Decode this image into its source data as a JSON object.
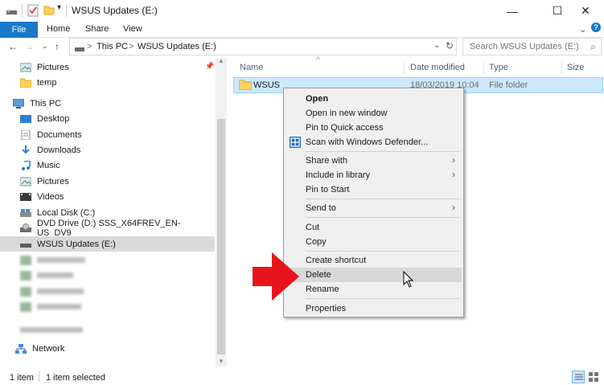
{
  "window": {
    "title": "WSUS Updates (E:)",
    "min_glyph": "—",
    "max_glyph": "☐",
    "close_glyph": "✕"
  },
  "ribbon": {
    "file": "File",
    "home": "Home",
    "share": "Share",
    "view": "View"
  },
  "address": {
    "crumb_pc": "This PC",
    "sep": ">",
    "crumb_drive": "WSUS Updates (E:)",
    "search_placeholder": "Search WSUS Updates (E:)"
  },
  "nav": {
    "items": [
      {
        "label": "Pictures",
        "icon": "pictures-icon"
      },
      {
        "label": "temp",
        "icon": "folder-icon"
      },
      {
        "label": "This PC",
        "icon": "pc-icon"
      },
      {
        "label": "Desktop",
        "icon": "desktop-icon"
      },
      {
        "label": "Documents",
        "icon": "documents-icon"
      },
      {
        "label": "Downloads",
        "icon": "downloads-icon"
      },
      {
        "label": "Music",
        "icon": "music-icon"
      },
      {
        "label": "Pictures",
        "icon": "pictures-icon"
      },
      {
        "label": "Videos",
        "icon": "videos-icon"
      },
      {
        "label": "Local Disk (C:)",
        "icon": "disk-icon"
      },
      {
        "label": "DVD Drive (D:) SSS_X64FREV_EN-US_DV9",
        "icon": "dvd-icon"
      },
      {
        "label": "WSUS Updates (E:)",
        "icon": "drive-icon"
      },
      {
        "label": "Network",
        "icon": "network-icon"
      }
    ]
  },
  "columns": {
    "name": "Name",
    "date": "Date modified",
    "type": "Type",
    "size": "Size"
  },
  "files": [
    {
      "name": "WSUS",
      "date": "18/03/2019 10:04",
      "type": "File folder"
    }
  ],
  "context_menu": {
    "open": "Open",
    "open_new_window": "Open in new window",
    "pin_quick": "Pin to Quick access",
    "scan": "Scan with Windows Defender...",
    "share_with": "Share with",
    "include_library": "Include in library",
    "pin_start": "Pin to Start",
    "send_to": "Send to",
    "cut": "Cut",
    "copy": "Copy",
    "create_shortcut": "Create shortcut",
    "delete": "Delete",
    "rename": "Rename",
    "properties": "Properties"
  },
  "status": {
    "count": "1 item",
    "selected": "1 item selected"
  },
  "colors": {
    "accent": "#1979ca",
    "selection": "#cce8ff",
    "arrow": "#e8141b"
  }
}
